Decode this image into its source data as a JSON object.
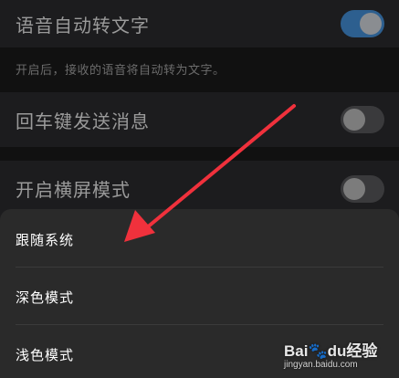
{
  "settings": {
    "voice_to_text": {
      "label": "语音自动转文字",
      "enabled": true
    },
    "voice_hint": "开启后，接收的语音将自动转为文字。",
    "enter_send": {
      "label": "回车键发送消息",
      "enabled": false
    },
    "landscape": {
      "label": "开启横屏模式",
      "enabled": false
    }
  },
  "sheet": {
    "items": [
      "跟随系统",
      "深色模式",
      "浅色模式"
    ]
  },
  "annotation": {
    "arrow_color": "#f0313c"
  },
  "watermark": {
    "logo_left": "Bai",
    "logo_paw": "du",
    "logo_right": "经验",
    "url": "jingyan.baidu.com"
  },
  "colors": {
    "toggle_on": "#2d5f8f",
    "toggle_off": "#3a3a3c",
    "row_bg": "#1c1c1e",
    "sheet_bg": "#2a2a2a"
  }
}
